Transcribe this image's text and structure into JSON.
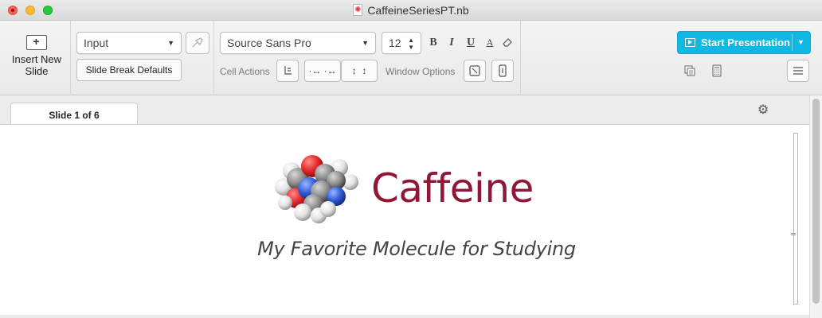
{
  "window": {
    "title": "CaffeineSeriesPT.nb"
  },
  "toolbar": {
    "insert_new_slide_line1": "Insert New",
    "insert_new_slide_line2": "Slide",
    "style_select_value": "Input",
    "slide_break_defaults_label": "Slide Break Defaults",
    "font_select_value": "Source Sans Pro",
    "font_size_value": "12",
    "bold_label": "B",
    "italic_label": "I",
    "underline_label": "U",
    "text_color_label": "A",
    "cell_actions_label": "Cell Actions",
    "window_options_label": "Window Options",
    "start_presentation_label": "Start Presentation"
  },
  "slide_tab": {
    "label": "Slide 1 of 6"
  },
  "slide": {
    "title": "Caffeine",
    "subtitle": "My Favorite Molecule for Studying",
    "title_color": "#921736"
  },
  "colors": {
    "accent_button": "#11b8e3",
    "oxygen": "#e0262a",
    "nitrogen": "#2f59d6",
    "carbon": "#8a8a8a",
    "hydrogen": "#e8e8e8"
  },
  "icons": [
    "insert-slide-icon",
    "chevron-down-icon",
    "style-brush-icon",
    "stepper-icon",
    "eraser-icon",
    "bracket-icon",
    "arrow-left-right-icon",
    "arrow-up-down-icon",
    "screen-fit-icon",
    "window-sidebar-icon",
    "play-icon",
    "copy-slides-icon",
    "calculator-icon",
    "menu-icon",
    "gear-icon",
    "caffeine-molecule-image"
  ]
}
